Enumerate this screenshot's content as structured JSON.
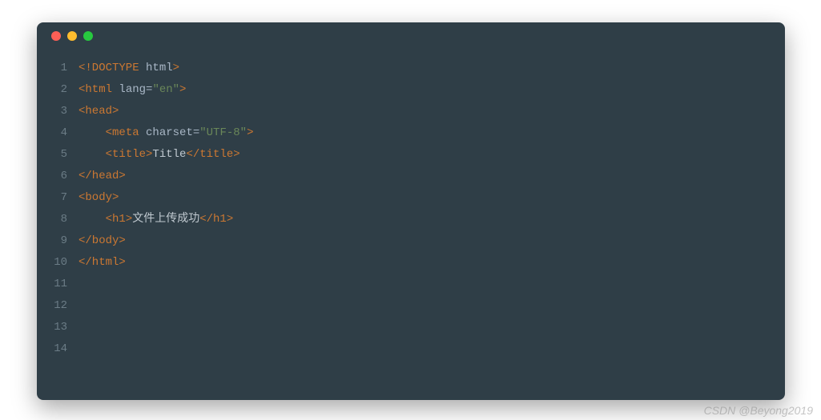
{
  "window": {
    "traffic_lights": [
      "close",
      "minimize",
      "maximize"
    ]
  },
  "code": {
    "lines": [
      {
        "n": "1",
        "segments": [
          {
            "c": "tag",
            "t": "<!DOCTYPE "
          },
          {
            "c": "attr",
            "t": "html"
          },
          {
            "c": "tag",
            "t": ">"
          }
        ]
      },
      {
        "n": "2",
        "segments": [
          {
            "c": "tag",
            "t": "<html "
          },
          {
            "c": "attr",
            "t": "lang="
          },
          {
            "c": "str",
            "t": "\"en\""
          },
          {
            "c": "tag",
            "t": ">"
          }
        ]
      },
      {
        "n": "3",
        "segments": [
          {
            "c": "tag",
            "t": "<head>"
          }
        ]
      },
      {
        "n": "4",
        "segments": [
          {
            "c": "txt",
            "t": "    "
          },
          {
            "c": "tag",
            "t": "<meta "
          },
          {
            "c": "attr",
            "t": "charset="
          },
          {
            "c": "str",
            "t": "\"UTF-8\""
          },
          {
            "c": "tag",
            "t": ">"
          }
        ]
      },
      {
        "n": "5",
        "segments": [
          {
            "c": "txt",
            "t": "    "
          },
          {
            "c": "tag",
            "t": "<title>"
          },
          {
            "c": "txt",
            "t": "Title"
          },
          {
            "c": "tag",
            "t": "</title>"
          }
        ]
      },
      {
        "n": "6",
        "segments": [
          {
            "c": "tag",
            "t": "</head>"
          }
        ]
      },
      {
        "n": "7",
        "segments": [
          {
            "c": "tag",
            "t": "<body>"
          }
        ]
      },
      {
        "n": "8",
        "segments": [
          {
            "c": "txt",
            "t": "    "
          },
          {
            "c": "tag",
            "t": "<h1>"
          },
          {
            "c": "txt",
            "t": "文件上传成功"
          },
          {
            "c": "tag",
            "t": "</h1>"
          }
        ]
      },
      {
        "n": "9",
        "segments": [
          {
            "c": "tag",
            "t": "</body>"
          }
        ]
      },
      {
        "n": "10",
        "segments": [
          {
            "c": "tag",
            "t": "</html>"
          }
        ]
      },
      {
        "n": "11",
        "segments": []
      },
      {
        "n": "12",
        "segments": []
      },
      {
        "n": "13",
        "segments": []
      },
      {
        "n": "14",
        "segments": []
      }
    ]
  },
  "watermark": "CSDN @Beyong2019"
}
